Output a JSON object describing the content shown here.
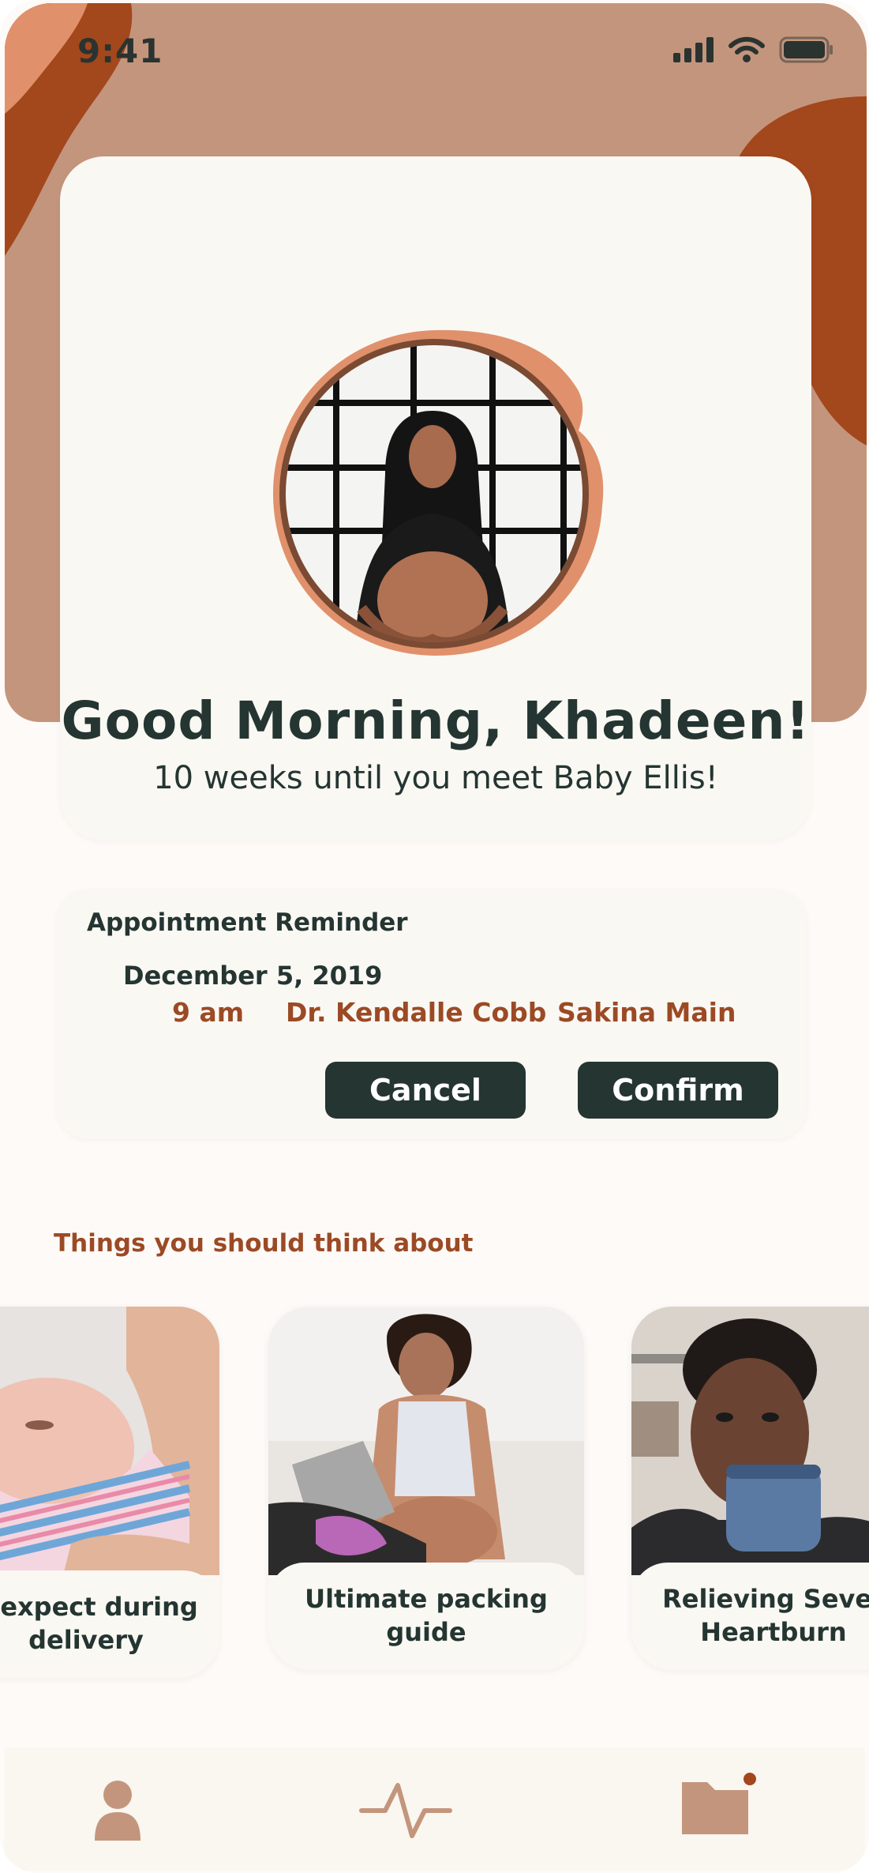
{
  "status_bar": {
    "time": "9:41"
  },
  "profile": {
    "greeting": "Good Morning, Khadeen!",
    "subtitle": "10 weeks until you meet Baby Ellis!"
  },
  "appointment": {
    "title": "Appointment Reminder",
    "date": "December 5, 2019",
    "time": "9 am",
    "doctor": "Dr. Kendalle Cobb",
    "location": "Sakina Main",
    "cancel_label": "Cancel",
    "confirm_label": "Confirm"
  },
  "topics": {
    "section_title": "Things you should think about",
    "items": [
      {
        "label_line1": "o expect during",
        "label_line2": "delivery"
      },
      {
        "label_line1": "Ultimate packing guide",
        "label_line2": ""
      },
      {
        "label_line1": "Relieving Sever",
        "label_line2": "Heartburn"
      }
    ]
  },
  "colors": {
    "header": "#c4957d",
    "accent_dark": "#a3471c",
    "accent_light": "#e0916b",
    "text_dark": "#243532",
    "text_accent": "#9b4a25",
    "card": "#faf8f3"
  },
  "tabbar": {
    "icons": [
      "person-icon",
      "pulse-icon",
      "folder-icon"
    ]
  }
}
